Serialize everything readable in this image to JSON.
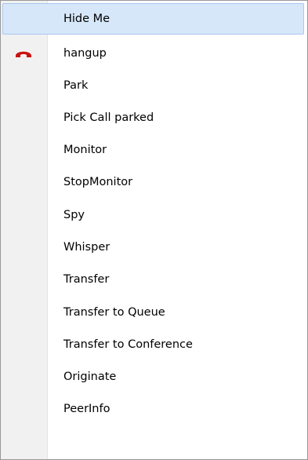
{
  "menu": {
    "items": [
      {
        "label": "Hide Me",
        "highlighted": true
      },
      {
        "label": "hangup",
        "icon": "hangup-phone-icon"
      },
      {
        "label": "Park"
      },
      {
        "label": "Pick Call parked"
      },
      {
        "label": "Monitor"
      },
      {
        "label": "StopMonitor"
      },
      {
        "label": "Spy"
      },
      {
        "label": "Whisper"
      },
      {
        "label": "Transfer"
      },
      {
        "label": "Transfer to Queue"
      },
      {
        "label": "Transfer to Conference"
      },
      {
        "label": "Originate"
      },
      {
        "label": "PeerInfo"
      }
    ]
  },
  "colors": {
    "highlight_bg": "#d7e7fa",
    "highlight_border": "#a8c7ee",
    "hangup_icon": "#cc1111"
  }
}
